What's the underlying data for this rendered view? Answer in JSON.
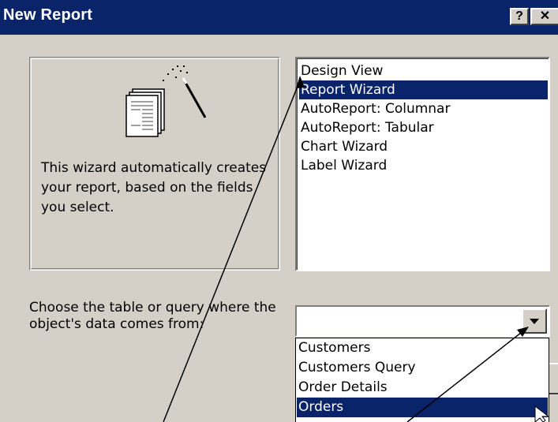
{
  "window": {
    "title": "New Report",
    "help_glyph": "?",
    "close_glyph": "✕"
  },
  "preview": {
    "description": "This wizard automatically creates your report, based on the fields you select.",
    "icon": "report-wizard-icon"
  },
  "report_types": {
    "items": [
      {
        "label": "Design View",
        "selected": false
      },
      {
        "label": "Report Wizard",
        "selected": true
      },
      {
        "label": "AutoReport:  Columnar",
        "selected": false
      },
      {
        "label": "AutoReport:  Tabular",
        "selected": false
      },
      {
        "label": "Chart Wizard",
        "selected": false
      },
      {
        "label": "Label Wizard",
        "selected": false
      }
    ]
  },
  "source": {
    "label": "Choose the table or query where the object's data comes from:",
    "value": "",
    "options": [
      {
        "label": "Customers",
        "selected": false
      },
      {
        "label": "Customers Query",
        "selected": false
      },
      {
        "label": "Order Details",
        "selected": false
      },
      {
        "label": "Orders",
        "selected": true
      }
    ]
  },
  "colors": {
    "title_bar": "#0a246a",
    "selection": "#0a246a",
    "dialog_face": "#d4d0c8"
  }
}
